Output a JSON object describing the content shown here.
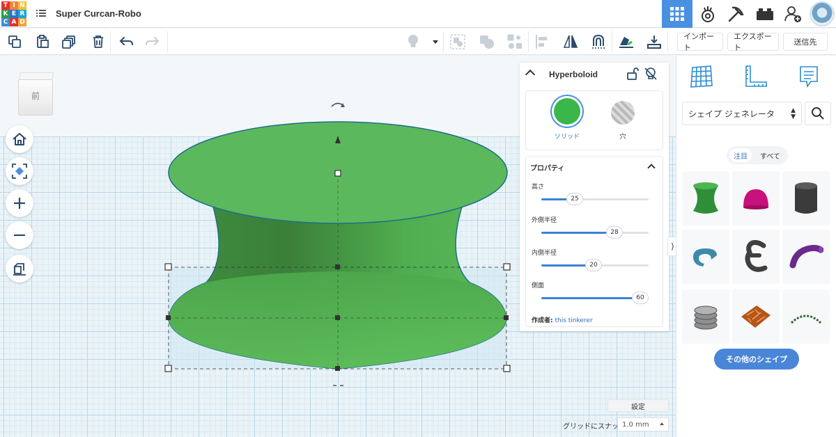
{
  "app": {
    "logo_letters": [
      "T",
      "I",
      "N",
      "K",
      "E",
      "R",
      "C",
      "A",
      "D"
    ],
    "logo_colors": [
      "#e2312d",
      "#f0833a",
      "#f7c035",
      "#2d9a48",
      "#2876c8",
      "#1aa4d9",
      "#3c8ed2",
      "#e2312d",
      "#f3a430"
    ],
    "project_title": "Super Curcan-Robo"
  },
  "topbar": {
    "icons": [
      "grid-view-icon",
      "circuits-icon",
      "pickaxe-icon",
      "bricks-icon",
      "add-user-icon",
      "avatar"
    ],
    "active_icon": "grid-view-icon",
    "accent": "#4a90e2"
  },
  "toolbar": {
    "left_tools": [
      "copy-icon",
      "paste-icon",
      "duplicate-icon",
      "delete-icon",
      "undo-icon",
      "redo-icon"
    ],
    "right_tools": [
      "light-bulb-icon",
      "group-icon",
      "ungroup-icon",
      "align-icon",
      "mirror-icon",
      "workplane-magnet-icon",
      "cruise-icon",
      "export-icon"
    ],
    "import_label": "インポート",
    "export_label": "エクスポート",
    "send_label": "送信先"
  },
  "viewport": {
    "view_cube_label": "前",
    "nav_buttons": [
      "home-icon",
      "fit-view-icon",
      "zoom-in-icon",
      "zoom-out-icon",
      "perspective-icon"
    ],
    "settings_label": "設定",
    "snap_label": "グリッドにスナップ",
    "snap_value": "1.0 mm",
    "shape_color": "#5cb85c"
  },
  "inspector": {
    "title": "Hyperboloid",
    "solid_label": "ソリッド",
    "hole_label": "穴",
    "properties_title": "プロパティ",
    "properties": [
      {
        "label": "高さ",
        "value": "25",
        "fraction": 0.31
      },
      {
        "label": "外側半径",
        "value": "28",
        "fraction": 0.68
      },
      {
        "label": "内側半径",
        "value": "20",
        "fraction": 0.49
      },
      {
        "label": "側面",
        "value": "60",
        "fraction": 0.98
      }
    ],
    "author_prefix": "作成者:",
    "author_name": "this tinkerer"
  },
  "right_panel": {
    "tabs": [
      "workplane-grid-icon",
      "ruler-icon",
      "notes-icon"
    ],
    "shape_category": "シェイプ ジェネレータ",
    "filters": [
      "注目",
      "すべて"
    ],
    "active_filter": "注目",
    "shapes": [
      "hyperboloid-shape",
      "paraboloid-shape",
      "cylinder-shape",
      "torus-shape",
      "epsilon-letter-shape",
      "bent-tube-shape",
      "spring-coil-shape",
      "tile-pattern-shape",
      "arc-text-shape"
    ],
    "more_shapes_label": "その他のシェイプ",
    "accent": "#4a86d8"
  }
}
